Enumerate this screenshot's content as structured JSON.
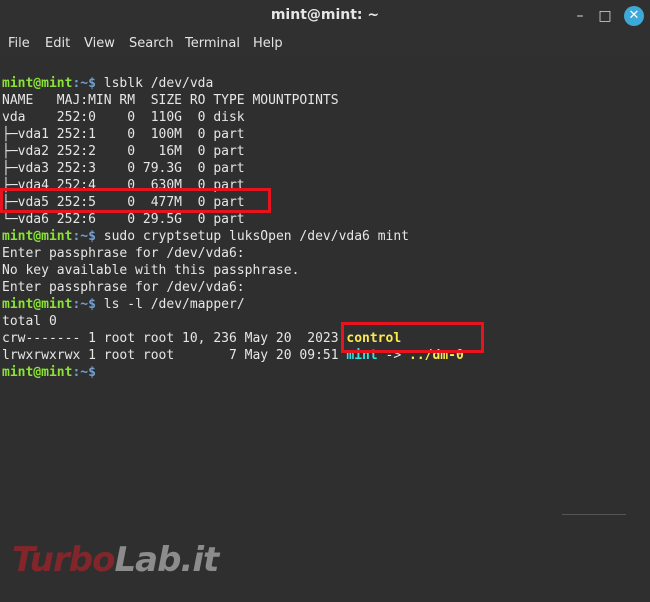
{
  "window": {
    "title": "mint@mint: ~",
    "controls": {
      "minimize": "–",
      "maximize": "□",
      "close": "✕"
    }
  },
  "menu": [
    "File",
    "Edit",
    "View",
    "Search",
    "Terminal",
    "Help"
  ],
  "terminal": {
    "prompt_user": "mint@mint",
    "prompt_sep": ":~$",
    "cmd1": " lsblk /dev/vda",
    "header": "NAME   MAJ:MIN RM  SIZE RO TYPE MOUNTPOINTS",
    "rows": [
      "vda    252:0    0  110G  0 disk",
      "├─vda1 252:1    0  100M  0 part",
      "├─vda2 252:2    0   16M  0 part",
      "├─vda3 252:3    0 79.3G  0 part",
      "├─vda4 252:4    0  630M  0 part",
      "├─vda5 252:5    0  477M  0 part",
      "└─vda6 252:6    0 29.5G  0 part"
    ],
    "cmd2": " sudo cryptsetup luksOpen /dev/vda6 mint",
    "out2": [
      "Enter passphrase for /dev/vda6:",
      "No key available with this passphrase.",
      "Enter passphrase for /dev/vda6:"
    ],
    "cmd3": " ls -l /dev/mapper/",
    "total": "total 0",
    "ls_row1_prefix": "crw------- 1 root root 10, 236 May 20  2023 ",
    "ls_row1_name": "control",
    "ls_row2_prefix": "lrwxrwxrwx 1 root root       7 May 20 09:51 ",
    "ls_row2_name": "mint",
    "ls_row2_arrow": " -> ",
    "ls_row2_target": "../dm-0"
  },
  "watermark": {
    "part1": "Turbo",
    "part2": "Lab.it"
  },
  "colors": {
    "accent_close": "#3ca9d6",
    "highlight": "#e8131d",
    "prompt_user": "#8ae234",
    "prompt_path": "#729fcf"
  }
}
